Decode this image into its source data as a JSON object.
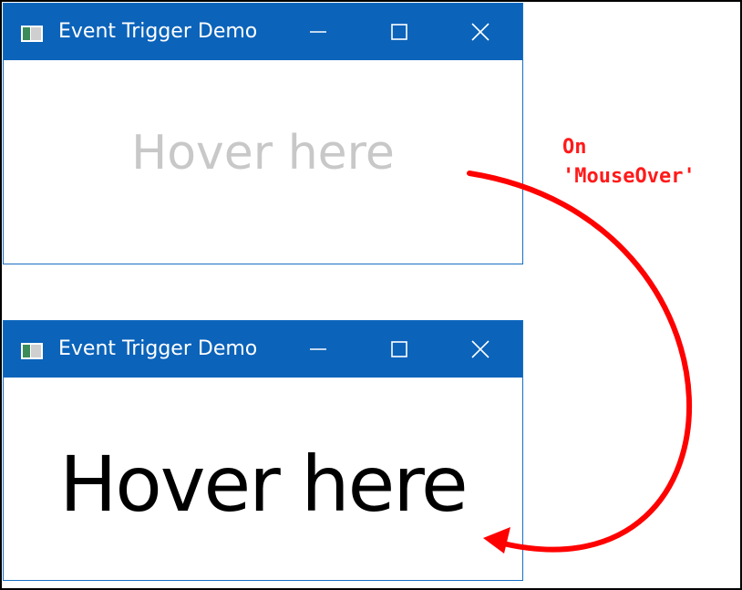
{
  "windows": [
    {
      "title": "Event Trigger Demo",
      "content_text": "Hover here",
      "state": "idle"
    },
    {
      "title": "Event Trigger Demo",
      "content_text": "Hover here",
      "state": "mouse-over"
    }
  ],
  "annotation": {
    "line1": "On",
    "line2": "'MouseOver'",
    "color": "#ff1a1a"
  },
  "colors": {
    "titlebar": "#0b63ba",
    "window_border": "#1a6fc4",
    "idle_text": "#c8c8c8",
    "active_text": "#000000"
  },
  "icons": {
    "app": "window-app-icon",
    "minimize": "minimize-icon",
    "maximize": "maximize-icon",
    "close": "close-icon"
  }
}
